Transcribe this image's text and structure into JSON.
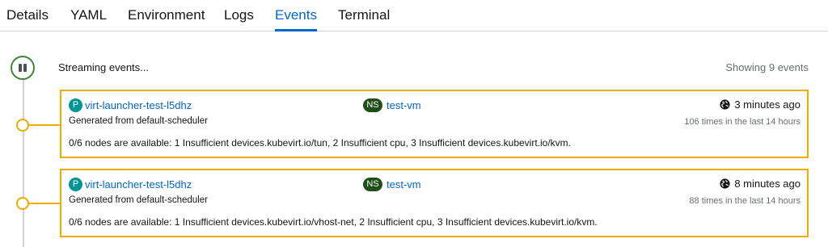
{
  "tabs": [
    {
      "label": "Details",
      "active": false
    },
    {
      "label": "YAML",
      "active": false
    },
    {
      "label": "Environment",
      "active": false
    },
    {
      "label": "Logs",
      "active": false
    },
    {
      "label": "Events",
      "active": true
    },
    {
      "label": "Terminal",
      "active": false
    }
  ],
  "stream": {
    "status_text": "Streaming events...",
    "showing_text": "Showing 9 events",
    "control_icon": "pause-icon"
  },
  "events": [
    {
      "pod_badge": "P",
      "pod_name": "virt-launcher-test-l5dhz",
      "ns_badge": "NS",
      "namespace": "test-vm",
      "source": "Generated from default-scheduler",
      "time": "3 minutes ago",
      "count": "106 times in the last 14 hours",
      "message": "0/6 nodes are available: 1 Insufficient devices.kubevirt.io/tun, 2 Insufficient cpu, 3 Insufficient devices.kubevirt.io/kvm."
    },
    {
      "pod_badge": "P",
      "pod_name": "virt-launcher-test-l5dhz",
      "ns_badge": "NS",
      "namespace": "test-vm",
      "source": "Generated from default-scheduler",
      "time": "8 minutes ago",
      "count": "88 times in the last 14 hours",
      "message": "0/6 nodes are available: 1 Insufficient devices.kubevirt.io/vhost-net, 2 Insufficient cpu, 3 Insufficient devices.kubevirt.io/kvm."
    }
  ],
  "colors": {
    "accent": "#0066cc",
    "warning": "#f0ab00",
    "streaming": "#3e8635",
    "pod_badge": "#009596",
    "ns_badge": "#1e4f18"
  }
}
